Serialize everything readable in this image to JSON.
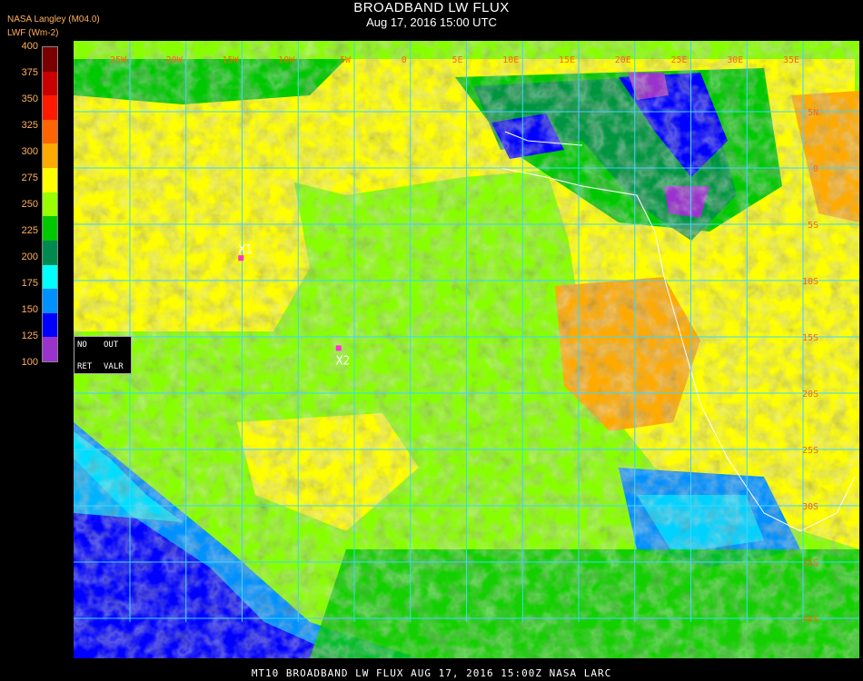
{
  "header": {
    "title": "BROADBAND LW FLUX",
    "subtitle": "Aug 17, 2016 15:00 UTC",
    "org": "NASA Langley (M04.0)",
    "unit": "LWF (Wm-2)"
  },
  "legend": {
    "ticks": [
      "400",
      "375",
      "350",
      "325",
      "300",
      "275",
      "250",
      "225",
      "200",
      "175",
      "150",
      "125",
      "100"
    ],
    "colors": [
      "#7a0000",
      "#c80000",
      "#ff1a00",
      "#ff6400",
      "#ffaa00",
      "#ffff00",
      "#99ff00",
      "#00c800",
      "#008a50",
      "#00ffff",
      "#0090ff",
      "#0000ff",
      "#9933cc"
    ]
  },
  "map": {
    "lon_labels": [
      "25W",
      "20W",
      "15W",
      "10W",
      "5W",
      "0",
      "5E",
      "10E",
      "15E",
      "20E",
      "25E",
      "30E",
      "35E"
    ],
    "lat_labels": [
      "5N",
      "0",
      "5S",
      "10S",
      "15S",
      "20S",
      "25S",
      "30S",
      "35S",
      "40S"
    ],
    "markers": [
      {
        "label": "X1",
        "lon": -15.1,
        "lat": -8.0
      },
      {
        "label": "X2",
        "lon": -6.4,
        "lat": -16.0
      }
    ],
    "grid_color": "#3ad7ff"
  },
  "no_data_box": {
    "no": "NO",
    "out": "OUT",
    "ret": "RET",
    "valr": "VALR"
  },
  "footer": "MT10  BROADBAND LW FLUX   AUG 17, 2016 15:00Z   NASA LARC"
}
